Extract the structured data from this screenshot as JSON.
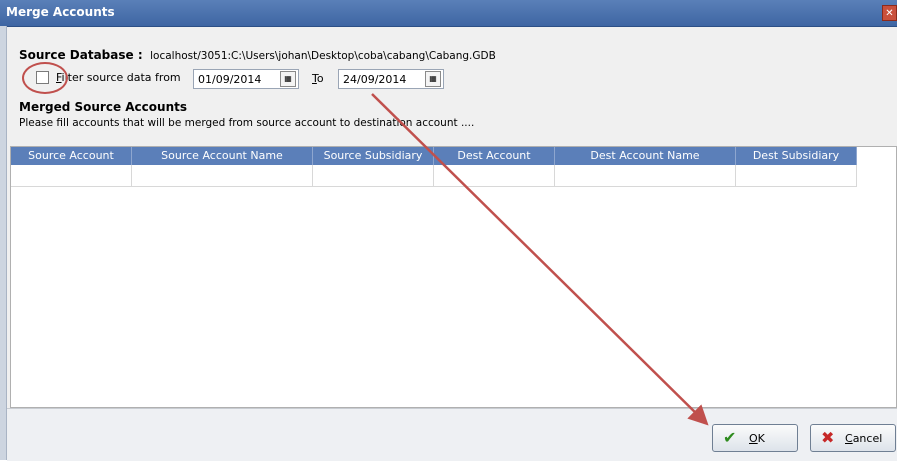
{
  "window": {
    "title": "Merge Accounts",
    "close_glyph": "✕"
  },
  "source": {
    "label": "Source Database :",
    "path": "localhost/3051:C:\\Users\\johan\\Desktop\\coba\\cabang\\Cabang.GDB"
  },
  "filter": {
    "label_first": "F",
    "label_rest": "ilter source data from",
    "from_date": "01/09/2014",
    "to_first": "T",
    "to_rest": "o",
    "to_date": "24/09/2014",
    "checked": false
  },
  "section": {
    "title": "Merged Source Accounts",
    "hint": "Please fill accounts that will be merged from source account to destination account ...."
  },
  "grid": {
    "columns": [
      "Source Account",
      "Source Account Name",
      "Source Subsidiary",
      "Dest Account",
      "Dest Account Name",
      "Dest Subsidiary"
    ]
  },
  "buttons": {
    "ok_first": "O",
    "ok_rest": "K",
    "cancel_first": "C",
    "cancel_rest": "ancel",
    "ok_icon": "check-icon",
    "cancel_icon": "x-icon"
  },
  "colors": {
    "header": "#5b7fb9",
    "annotation": "#c0504d",
    "ok_check": "#2e8b1e",
    "cancel_x": "#c62828"
  }
}
